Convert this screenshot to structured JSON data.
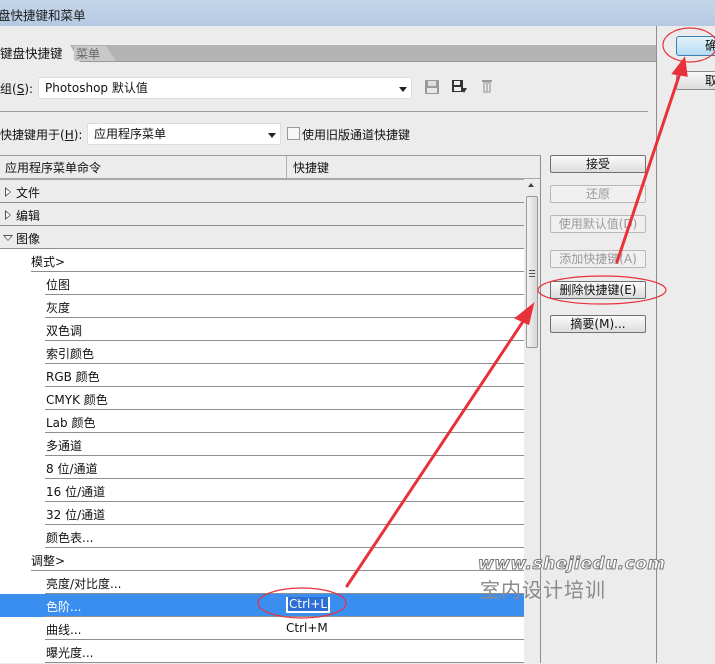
{
  "window": {
    "title": "盘快捷键和菜单"
  },
  "tabs": [
    {
      "label": "键盘快捷键",
      "active": true
    },
    {
      "label": "菜单",
      "active": false
    }
  ],
  "set": {
    "label_prefix": "组(",
    "label_key": "S",
    "label_suffix": "):",
    "value": "Photoshop 默认值",
    "icons": [
      "save-set-icon",
      "save-as-icon",
      "delete-set-icon"
    ]
  },
  "shortcuts_for": {
    "label_prefix": "快捷键用于(",
    "label_key": "H",
    "label_suffix": "):",
    "value": "应用程序菜单",
    "legacy_checkbox_label": "使用旧版通道快捷键",
    "legacy_checked": false
  },
  "table": {
    "col_command": "应用程序菜单命令",
    "col_shortcut": "快捷键",
    "rows": [
      {
        "type": "group",
        "label": "文件",
        "expanded": false,
        "shortcut": ""
      },
      {
        "type": "group",
        "label": "编辑",
        "expanded": false,
        "shortcut": ""
      },
      {
        "type": "group",
        "label": "图像",
        "expanded": true,
        "shortcut": ""
      },
      {
        "type": "sub",
        "label": "模式>",
        "shortcut": ""
      },
      {
        "type": "item",
        "label": "位图",
        "shortcut": ""
      },
      {
        "type": "item",
        "label": "灰度",
        "shortcut": ""
      },
      {
        "type": "item",
        "label": "双色调",
        "shortcut": ""
      },
      {
        "type": "item",
        "label": "索引颜色",
        "shortcut": ""
      },
      {
        "type": "item",
        "label": "RGB 颜色",
        "shortcut": ""
      },
      {
        "type": "item",
        "label": "CMYK 颜色",
        "shortcut": ""
      },
      {
        "type": "item",
        "label": "Lab 颜色",
        "shortcut": ""
      },
      {
        "type": "item",
        "label": "多通道",
        "shortcut": ""
      },
      {
        "type": "item",
        "label": "8 位/通道",
        "shortcut": ""
      },
      {
        "type": "item",
        "label": "16 位/通道",
        "shortcut": ""
      },
      {
        "type": "item",
        "label": "32 位/通道",
        "shortcut": ""
      },
      {
        "type": "item",
        "label": "颜色表...",
        "shortcut": ""
      },
      {
        "type": "sub",
        "label": "调整>",
        "shortcut": ""
      },
      {
        "type": "item",
        "label": "亮度/对比度...",
        "shortcut": ""
      },
      {
        "type": "item",
        "label": "色阶...",
        "shortcut": "Ctrl+L",
        "selected": true,
        "editing": true
      },
      {
        "type": "item",
        "label": "曲线...",
        "shortcut": "Ctrl+M"
      },
      {
        "type": "item",
        "label": "曝光度...",
        "shortcut": ""
      }
    ]
  },
  "side_buttons": [
    {
      "label": "接受",
      "enabled": true
    },
    {
      "label": "还原",
      "enabled": false
    },
    {
      "label": "使用默认值(D)",
      "enabled": false
    },
    {
      "label": "添加快捷键(A)",
      "enabled": false
    },
    {
      "label": "删除快捷键(E)",
      "enabled": true,
      "annotated": true
    },
    {
      "label": "摘要(M)...",
      "enabled": true
    }
  ],
  "dialog_buttons": {
    "ok": "确",
    "cancel": "取"
  },
  "watermark": {
    "url": "www.shejiedu.com",
    "text": "室内设计培训"
  },
  "annotation_color": "#e8313a"
}
